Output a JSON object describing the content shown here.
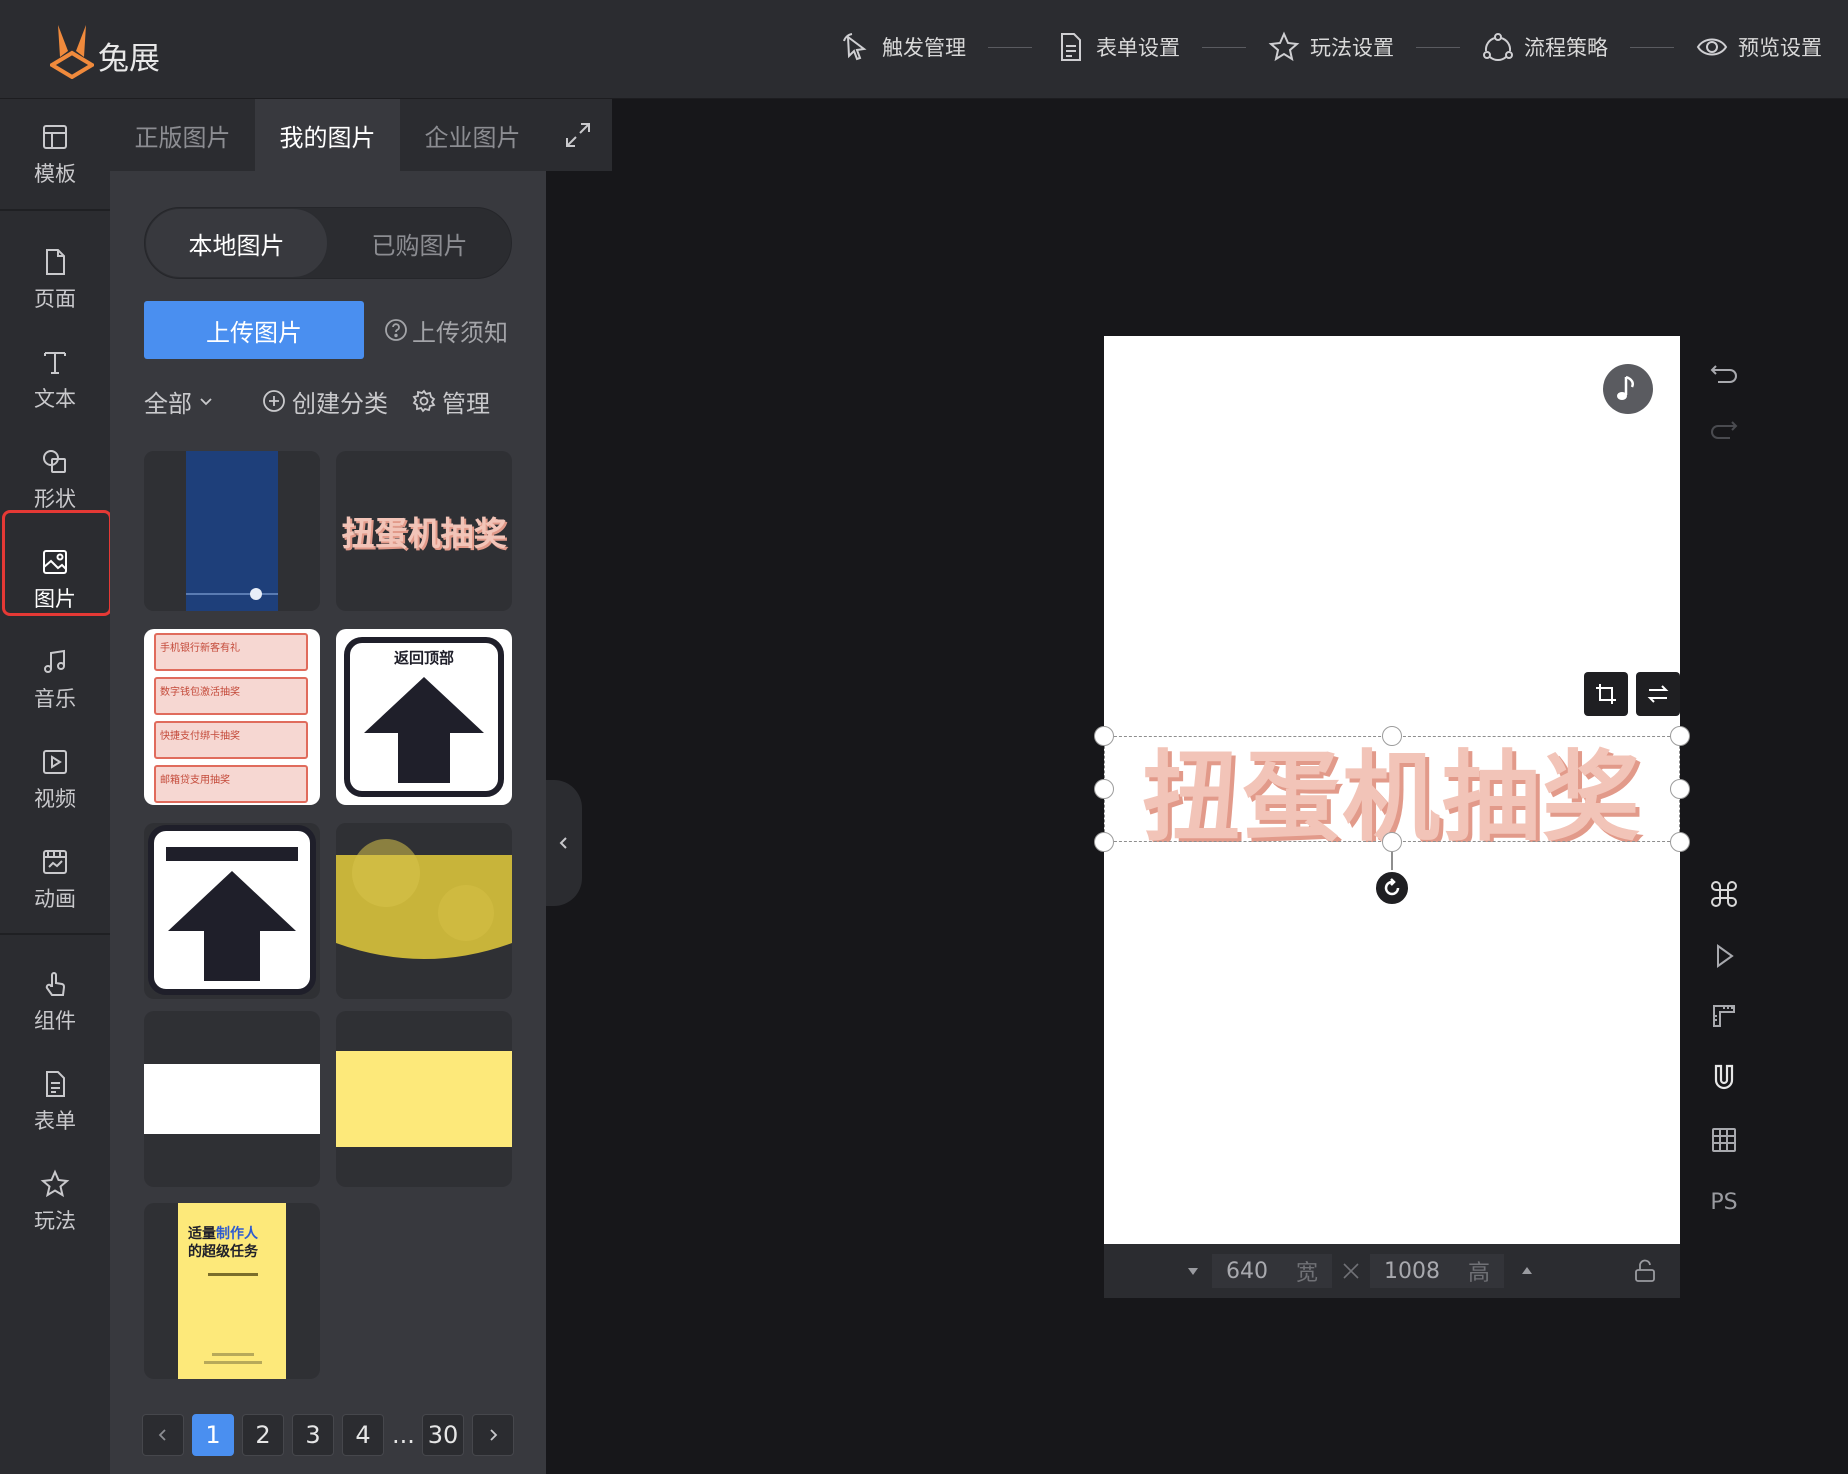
{
  "app": {
    "brand": "兔展"
  },
  "steps": [
    {
      "label": "触发管理",
      "icon": "pointer-icon"
    },
    {
      "label": "表单设置",
      "icon": "form-icon"
    },
    {
      "label": "玩法设置",
      "icon": "star-icon"
    },
    {
      "label": "流程策略",
      "icon": "flow-icon"
    },
    {
      "label": "预览设置",
      "icon": "eye-icon"
    }
  ],
  "nav": [
    {
      "label": "模板",
      "icon": "template-icon"
    },
    {
      "label": "页面",
      "icon": "page-icon"
    },
    {
      "label": "文本",
      "icon": "text-icon"
    },
    {
      "label": "形状",
      "icon": "shape-icon"
    },
    {
      "label": "图片",
      "icon": "image-icon",
      "active": true
    },
    {
      "label": "音乐",
      "icon": "music-icon"
    },
    {
      "label": "视频",
      "icon": "video-icon"
    },
    {
      "label": "动画",
      "icon": "animation-icon"
    },
    {
      "label": "组件",
      "icon": "component-icon"
    },
    {
      "label": "表单",
      "icon": "form-icon"
    },
    {
      "label": "玩法",
      "icon": "gameplay-icon"
    }
  ],
  "panel": {
    "tabs": [
      "正版图片",
      "我的图片",
      "企业图片"
    ],
    "active_tab": "我的图片",
    "segments": [
      "本地图片",
      "已购图片"
    ],
    "active_segment": "本地图片",
    "upload_label": "上传图片",
    "notice_label": "上传须知",
    "filter_all": "全部",
    "create_label": "创建分类",
    "manage_label": "管理",
    "thumbs": {
      "t2_text": "扭蛋机抽奖",
      "t4_text": "返回顶部",
      "t3_rows": [
        "手机银行新客有礼",
        "数字钱包激活抽奖",
        "快捷支付绑卡抽奖",
        "邮箱贷支用抽奖"
      ],
      "t9_title_a": "适量",
      "t9_title_b": "制作人",
      "t9_title_c": "的超级任务"
    },
    "pages": [
      "1",
      "2",
      "3",
      "4",
      "30"
    ],
    "current_page": "1",
    "ellipsis": "..."
  },
  "canvas": {
    "selected_text": "扭蛋机抽奖",
    "width_value": "640",
    "width_label": "宽",
    "height_value": "1008",
    "height_label": "高"
  },
  "right_tools": [
    {
      "icon": "undo-icon"
    },
    {
      "icon": "redo-icon"
    },
    {
      "icon": "command-icon"
    },
    {
      "icon": "play-icon"
    },
    {
      "icon": "ruler-icon"
    },
    {
      "icon": "magnet-icon"
    },
    {
      "icon": "grid-icon"
    },
    {
      "label": "PS",
      "icon": "ps-label"
    }
  ],
  "colors": {
    "accent": "#4a8ff0",
    "active_outline": "#e53935",
    "logo": "#f08a3c"
  }
}
